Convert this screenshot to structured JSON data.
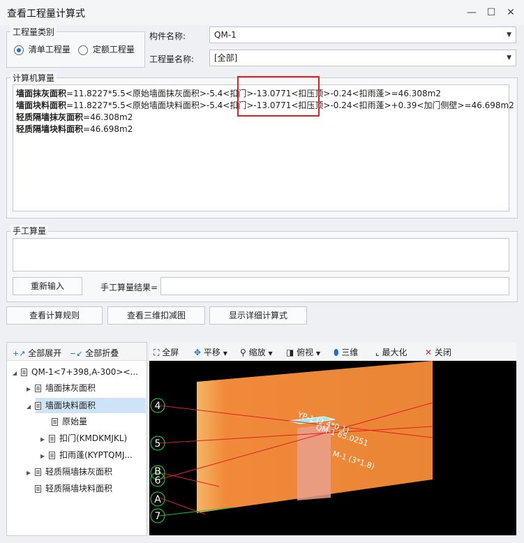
{
  "window": {
    "title": "查看工程量计算式",
    "minimize": "—",
    "maximize": "☐",
    "close": "✕"
  },
  "quantity_type": {
    "label": "工程量类别",
    "options": [
      {
        "label": "清单工程量",
        "selected": true
      },
      {
        "label": "定额工程量",
        "selected": false
      }
    ]
  },
  "component": {
    "label": "构件名称:",
    "value": "QM-1"
  },
  "quantity_name": {
    "label": "工程量名称:",
    "value": "[全部]"
  },
  "computer_calc": {
    "label": "计算机算量",
    "lines": [
      {
        "name": "墙面抹灰面积",
        "formula": "=11.8227*5.5<原始墙面抹灰面积>-5.4<扣门>-13.0771<扣压顶>-0.24<扣雨蓬>=46.308m2"
      },
      {
        "name": "墙面块料面积",
        "formula": "=11.8227*5.5<原始墙面块料面积>-5.4<扣门>-13.0771<扣压顶>-0.24<扣雨蓬>+0.39<加门侧壁>=46.698m2"
      },
      {
        "name": "轻质隔墙抹灰面积",
        "formula": "=46.308m2"
      },
      {
        "name": "轻质隔墙块料面积",
        "formula": "=46.698m2"
      }
    ]
  },
  "manual_calc": {
    "label": "手工算量",
    "reenter_button": "重新输入",
    "result_label": "手工算量结果=",
    "result_value": ""
  },
  "actions": {
    "rules": "查看计算规则",
    "view3d": "查看三维扣减图",
    "detail": "显示详细计算式"
  },
  "tree_toolbar": {
    "expand_all": "全部展开",
    "collapse_all": "全部折叠"
  },
  "tree": [
    {
      "label": "QM-1<7+398,A-300><...",
      "level": 0,
      "toggle": "down"
    },
    {
      "label": "墙面抹灰面积",
      "level": 1,
      "toggle": "right"
    },
    {
      "label": "墙面块料面积",
      "level": 1,
      "toggle": "down",
      "selected": true
    },
    {
      "label": "原始量",
      "level": 2,
      "toggle": "none"
    },
    {
      "label": "扣门(KMDKMJKL)",
      "level": 2,
      "toggle": "right"
    },
    {
      "label": "扣雨蓬(KYPTQMJ...",
      "level": 2,
      "toggle": "right"
    },
    {
      "label": "轻质隔墙抹灰面积",
      "level": 1,
      "toggle": "right"
    },
    {
      "label": "轻质隔墙块料面积",
      "level": 1,
      "toggle": "none"
    }
  ],
  "view_toolbar": {
    "fullscreen": "全屏",
    "pan": "平移",
    "zoom": "缩放",
    "topview": "俯视",
    "three_d": "三维",
    "maximize": "最大化",
    "close": "关闭"
  },
  "scene": {
    "axis_labels": [
      "4",
      "5",
      "B",
      "6",
      "A",
      "7"
    ],
    "labels": {
      "canopy": "YP-1 (2.4*0.1)",
      "wall": "QM-1 65.0251",
      "door": "M-1 (3*1.8)"
    },
    "colors": {
      "wall": "#f08a3a",
      "canopy": "#9fe8ee",
      "axis": "#18c23a",
      "axis_line": "#e02020"
    }
  }
}
